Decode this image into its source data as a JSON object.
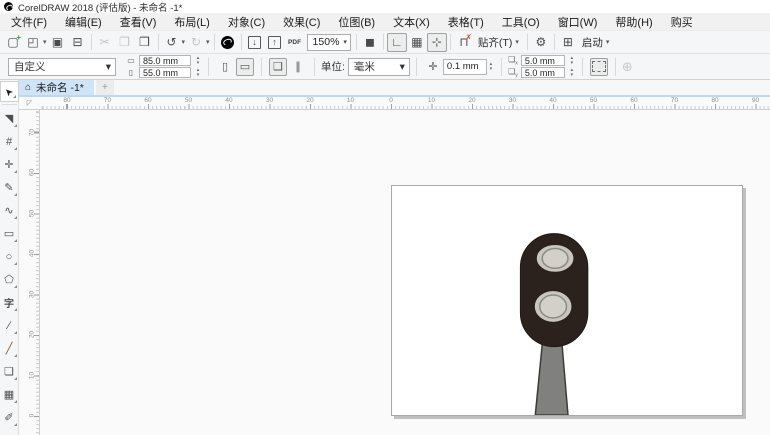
{
  "title_bar": {
    "app_title": "CorelDRAW 2018 (评估版) - 未命名 -1*"
  },
  "menu_bar": {
    "items": [
      "文件(F)",
      "编辑(E)",
      "查看(V)",
      "布局(L)",
      "对象(C)",
      "效果(C)",
      "位图(B)",
      "文本(X)",
      "表格(T)",
      "工具(O)",
      "窗口(W)",
      "帮助(H)",
      "购买"
    ]
  },
  "toolbar": {
    "zoom_value": "150%",
    "snap_label": "贴齐(T)",
    "launch_label": "启动",
    "items": [
      {
        "name": "new-document-icon",
        "glyph": "▢",
        "overlay": "+",
        "overlay_color": "#3fa03f"
      },
      {
        "name": "open-folder-icon",
        "glyph": "◰",
        "dropdown": true
      },
      {
        "name": "save-icon",
        "glyph": "▣"
      },
      {
        "name": "print-icon",
        "glyph": "⊟"
      },
      {
        "sep": true
      },
      {
        "name": "cut-icon",
        "glyph": "✂",
        "disabled": true
      },
      {
        "name": "copy-icon",
        "glyph": "❐",
        "disabled": true
      },
      {
        "name": "paste-icon",
        "glyph": "❒"
      },
      {
        "sep": true
      },
      {
        "name": "undo-icon",
        "glyph": "↺",
        "dropdown": true
      },
      {
        "name": "redo-icon",
        "glyph": "↻",
        "disabled": true,
        "dropdown": true
      },
      {
        "sep": true
      },
      {
        "name": "coreldraw-welcome-icon",
        "ball": true
      },
      {
        "sep": true
      },
      {
        "name": "import-icon",
        "glyph": "↓",
        "boxed": true
      },
      {
        "name": "export-icon",
        "glyph": "↑",
        "boxed": true
      },
      {
        "name": "publish-pdf-icon",
        "pdftext": "PDF\nᴴ"
      },
      {
        "zoom_combo": true
      },
      {
        "sep": true
      },
      {
        "name": "fullscreen-preview-icon",
        "glyph": "◼"
      },
      {
        "sep": true
      },
      {
        "name": "show-rulers-icon",
        "glyph": "∟",
        "active": true
      },
      {
        "name": "show-grid-icon",
        "glyph": "▦"
      },
      {
        "name": "show-guidelines-icon",
        "glyph": "⊹",
        "active": true
      },
      {
        "sep": true
      },
      {
        "name": "snap-off-icon",
        "glyph": "⊓",
        "overlay": "✗",
        "overlay_color": "#d23b2e"
      },
      {
        "name": "snap-to-button",
        "textbtn": "snap",
        "dropdown": true
      },
      {
        "sep": true
      },
      {
        "name": "options-gear-icon",
        "glyph": "⚙"
      },
      {
        "sep": true
      },
      {
        "name": "launcher-icon",
        "glyph": "⊞"
      },
      {
        "name": "launch-button",
        "textbtn": "launch",
        "dropdown": true
      }
    ]
  },
  "property_bar": {
    "preset_value": "自定义",
    "page_width": "85.0 mm",
    "page_height": "55.0 mm",
    "units_label": "单位:",
    "units_value": "毫米",
    "nudge_value": "0.1 mm",
    "duplicate_x": "5.0 mm",
    "duplicate_y": "5.0 mm"
  },
  "document_tabs": {
    "home_icon": "⌂",
    "active_tab": "未命名 -1*",
    "new_tab": "+"
  },
  "rulers": {
    "corner_glyph": "◸",
    "h_labels": [
      "80",
      "70",
      "60",
      "50",
      "40",
      "30",
      "20",
      "10",
      "0",
      "10",
      "20",
      "30",
      "40",
      "50",
      "60",
      "70",
      "80",
      "90"
    ],
    "v_labels": [
      "70",
      "60",
      "50",
      "40",
      "30",
      "20",
      "10",
      "0"
    ]
  },
  "toolbox": {
    "tools": [
      {
        "name": "pick-tool",
        "glyph": "➤",
        "selected": true
      },
      {
        "name": "shape-tool",
        "glyph": "◥"
      },
      {
        "name": "crop-tool",
        "glyph": "#"
      },
      {
        "name": "pan-tool",
        "glyph": "✛"
      },
      {
        "name": "freehand-tool",
        "glyph": "✎"
      },
      {
        "name": "bspline-tool",
        "glyph": "∿"
      },
      {
        "name": "rectangle-tool",
        "glyph": "▭"
      },
      {
        "name": "ellipse-tool",
        "glyph": "○"
      },
      {
        "name": "polygon-tool",
        "glyph": "⬠"
      },
      {
        "name": "text-tool",
        "glyph": "字"
      },
      {
        "name": "dimension-tool",
        "glyph": "∕"
      },
      {
        "name": "connector-tool",
        "glyph": "╱"
      },
      {
        "name": "drop-shadow-tool",
        "glyph": "❏"
      },
      {
        "name": "transparency-tool",
        "glyph": "▦"
      },
      {
        "name": "eyedropper-tool",
        "glyph": "✐"
      }
    ]
  },
  "drawing": {
    "page_color": "#ffffff",
    "body_color": "#2b221e",
    "body_stroke": "#1e1713",
    "lamp_ring_fill": "#c9c6c0",
    "lamp_ring_stroke": "#2a211c",
    "lamp_inner_fill": "#d3d0ca",
    "lamp_inner_stroke": "#8d8a84",
    "pole_fill": "#80807e",
    "pole_stroke": "#3c3a38"
  }
}
